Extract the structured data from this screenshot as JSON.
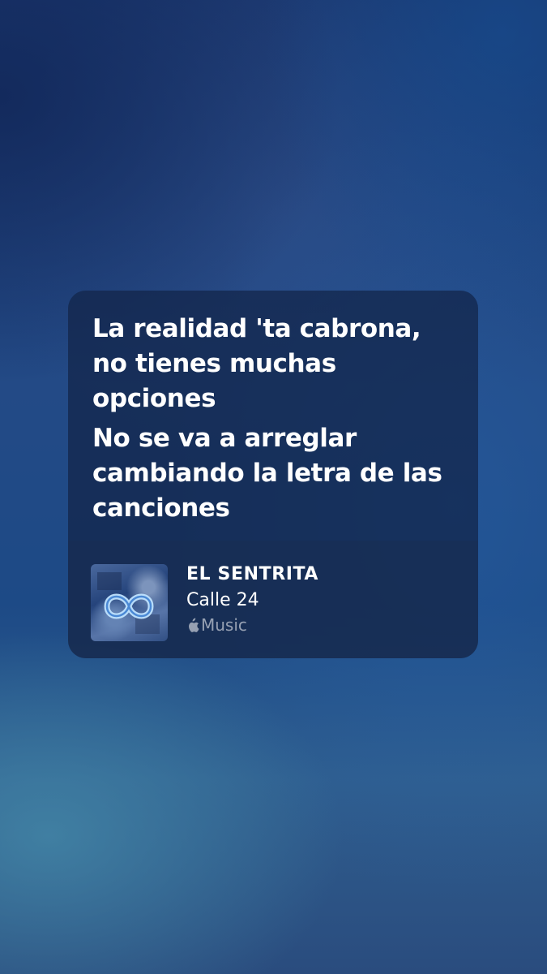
{
  "lyrics": {
    "lines": [
      "La realidad 'ta cabrona, no tienes muchas opciones",
      "No se va a arreglar cambiando la letra de las canciones"
    ]
  },
  "track": {
    "artist": "EL SENTRITA",
    "album": "Calle 24",
    "service_label": "Music",
    "service_icon": "apple-logo-icon",
    "cover_icon": "album-cover"
  },
  "colors": {
    "text_primary": "#ffffff",
    "text_secondary": "#8ea0bb",
    "background_accent": "#234a86"
  }
}
